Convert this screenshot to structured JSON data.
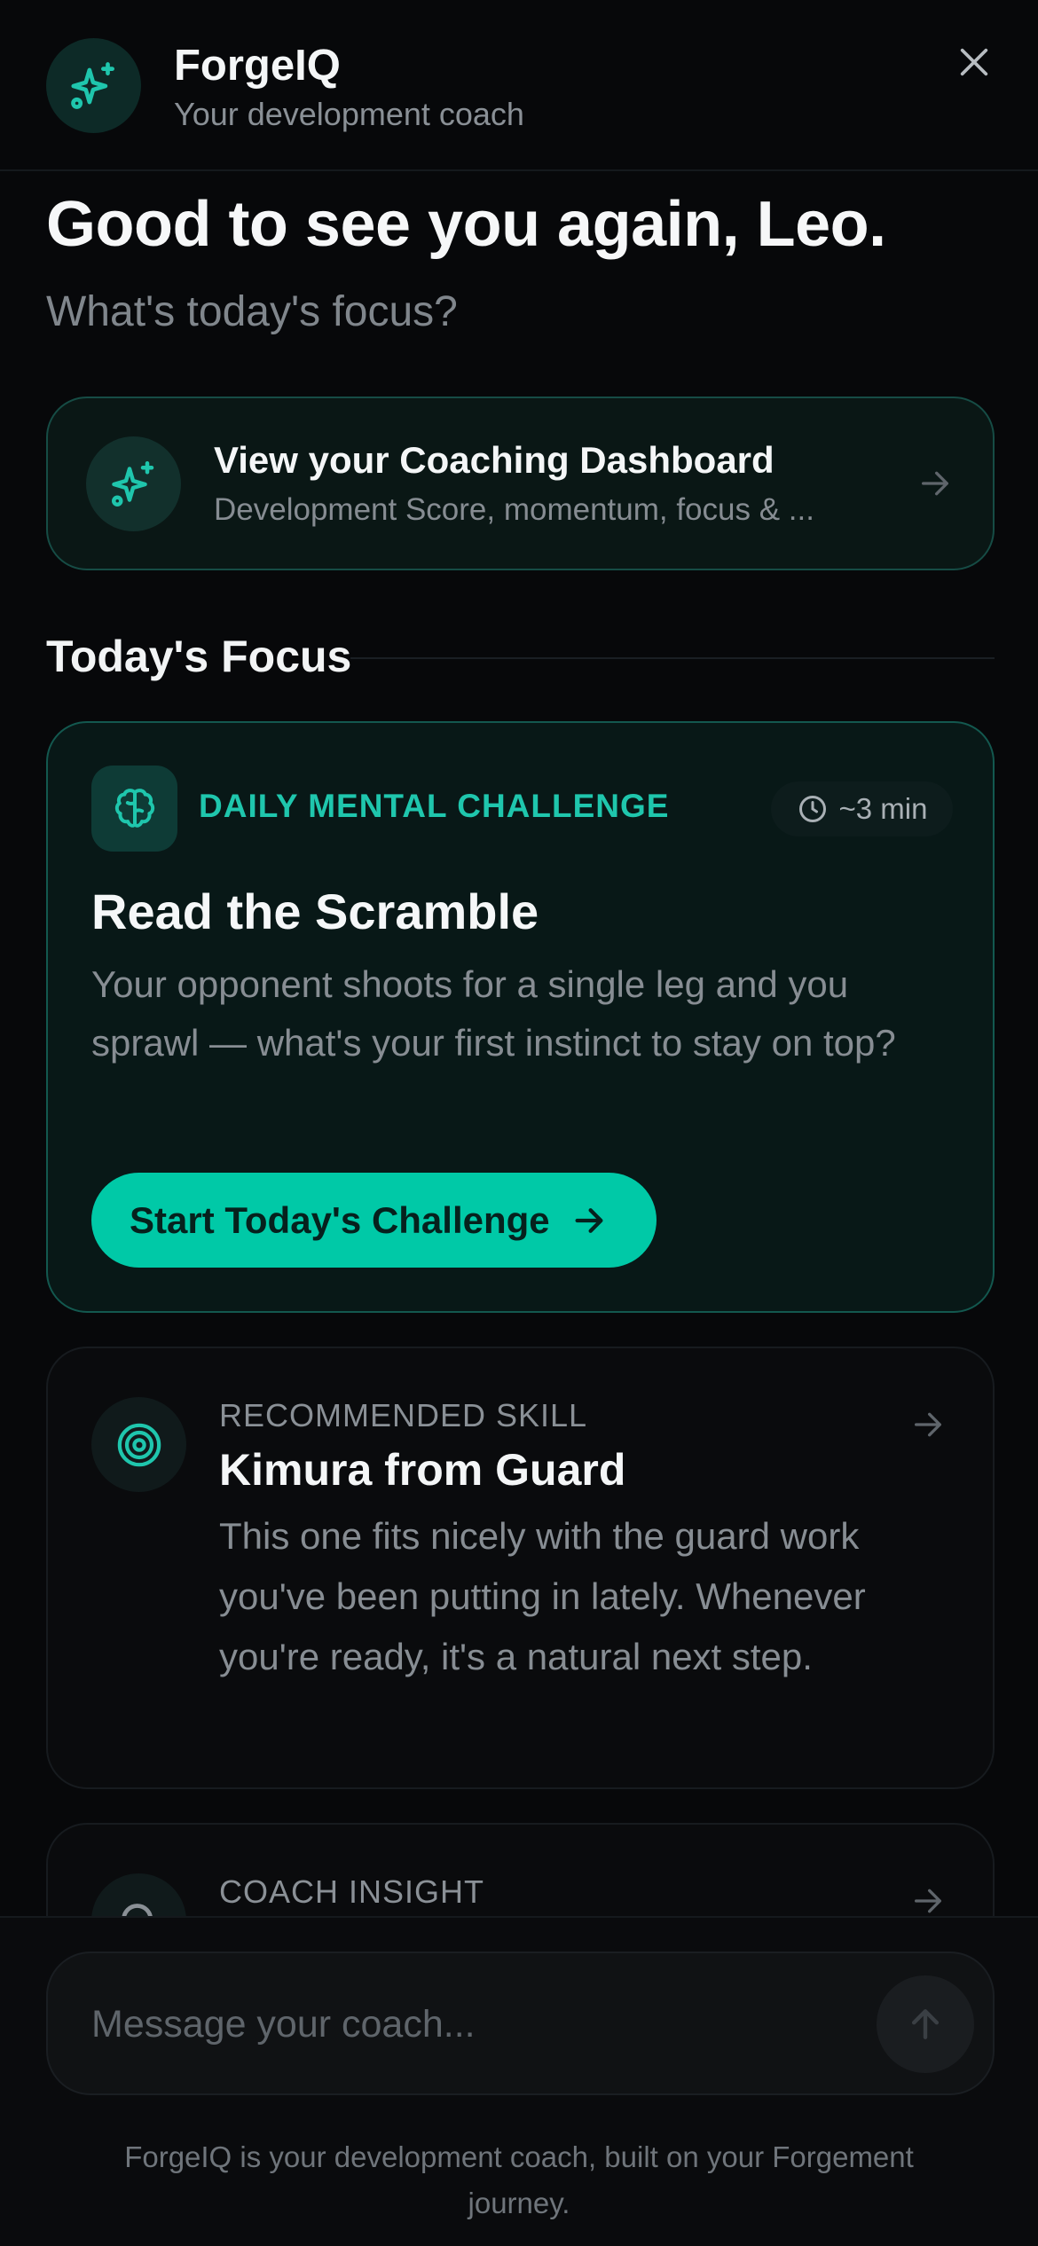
{
  "header": {
    "title": "ForgeIQ",
    "subtitle": "Your development coach",
    "logo_icon": "sparkles-icon",
    "close_icon": "close-icon"
  },
  "greeting": {
    "title": "Good to see you again, Leo.",
    "subtitle": "What's today's focus?"
  },
  "dashboard_link": {
    "title": "View your Coaching Dashboard",
    "subtitle": "Development Score, momentum, focus & ...",
    "icon": "sparkles-icon",
    "arrow_icon": "arrow-right-icon"
  },
  "section": {
    "title": "Today's Focus"
  },
  "challenge": {
    "label": "DAILY MENTAL CHALLENGE",
    "time": "~3 min",
    "title": "Read the Scramble",
    "body": "Your opponent shoots for a single leg and you sprawl — what's your first instinct to stay on top?",
    "button_label": "Start Today's Challenge",
    "icon": "brain-icon"
  },
  "skill": {
    "label": "RECOMMENDED SKILL",
    "title": "Kimura from Guard",
    "body": "This one fits nicely with the guard work you've been putting in lately. Whenever you're ready, it's a natural next step.",
    "icon": "target-icon"
  },
  "insight": {
    "label": "COACH INSIGHT"
  },
  "composer": {
    "placeholder": "Message your coach...",
    "send_icon": "arrow-up-icon"
  },
  "footnote": "ForgeIQ is your development coach, built on your Forgement journey.",
  "colors": {
    "background": "#07080a",
    "accent": "#00c9a7",
    "accent_text": "#1fc6ad"
  }
}
